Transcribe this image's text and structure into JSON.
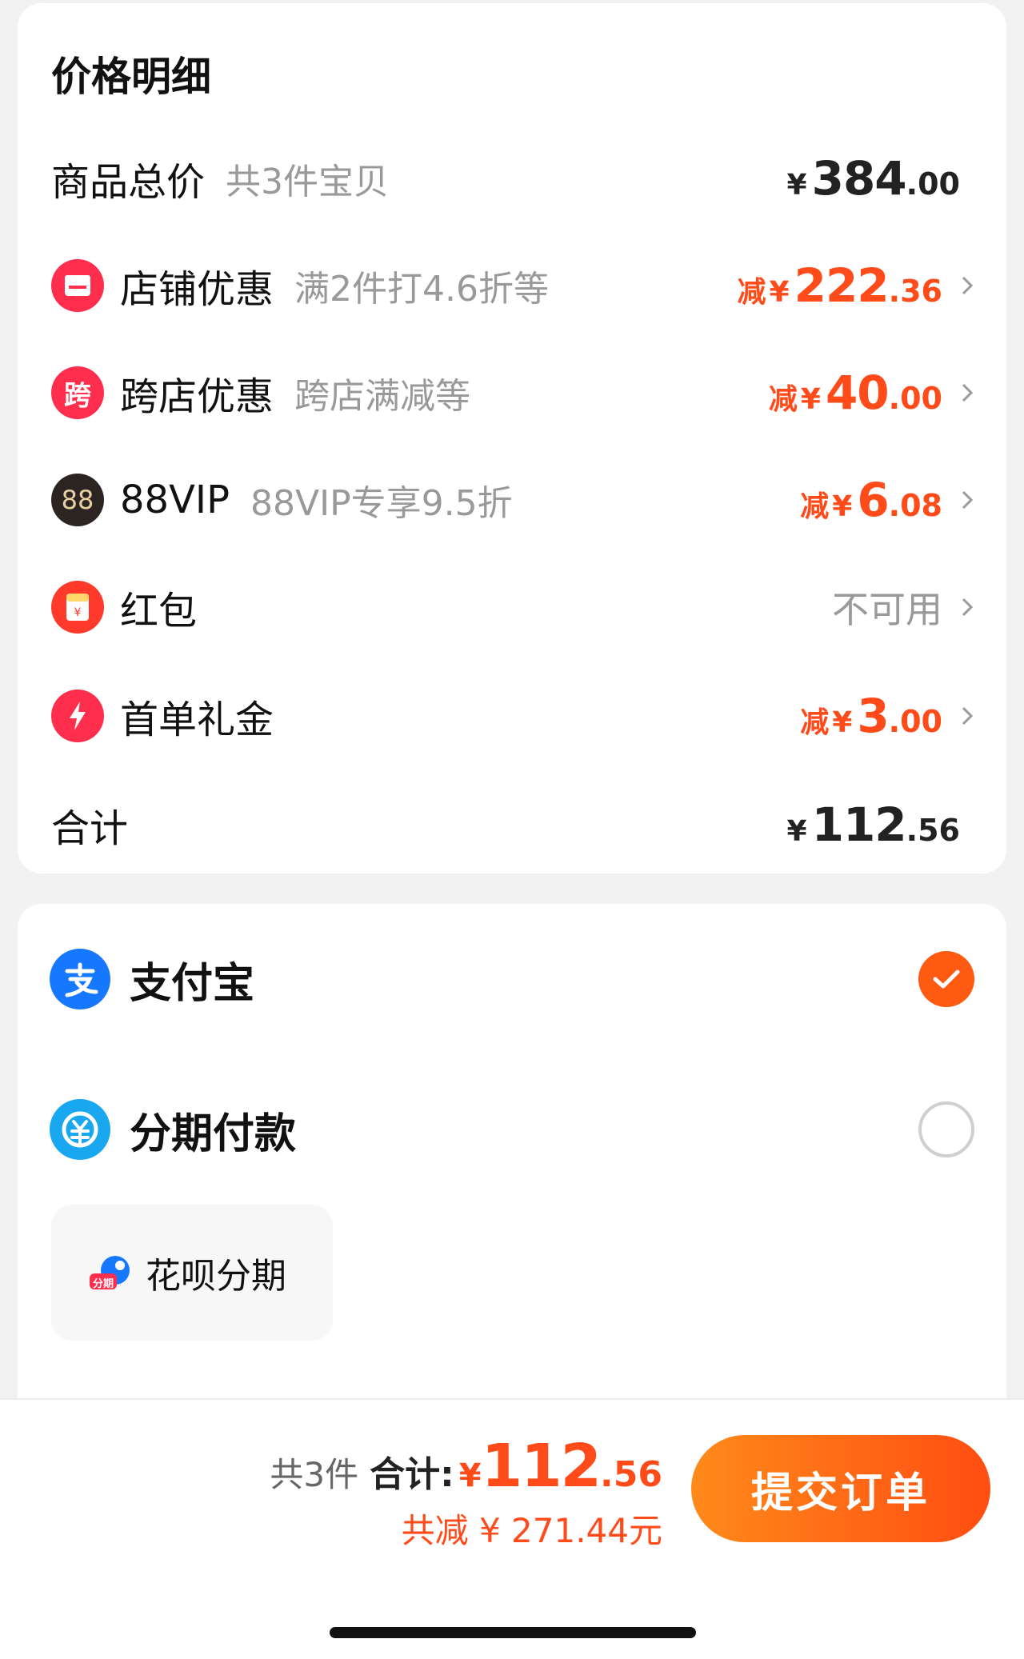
{
  "price_detail": {
    "title": "价格明细",
    "rows": [
      {
        "label": "商品总价",
        "desc": "共3件宝贝",
        "value_prefix": "",
        "yen": "¥",
        "value_int": "384",
        "value_dec": ".00"
      },
      {
        "label": "店铺优惠",
        "desc": "满2件打4.6折等",
        "value_prefix": "减",
        "yen": "¥",
        "value_int": "222",
        "value_dec": ".36",
        "icon": "shop-icon"
      },
      {
        "label": "跨店优惠",
        "desc": "跨店满减等",
        "value_prefix": "减",
        "yen": "¥",
        "value_int": "40",
        "value_dec": ".00",
        "icon": "cross-store-icon",
        "icon_text": "跨"
      },
      {
        "label": "88VIP",
        "desc": "88VIP专享9.5折",
        "value_prefix": "减",
        "yen": "¥",
        "value_int": "6",
        "value_dec": ".08",
        "icon": "vip-88-icon",
        "icon_text": "88"
      },
      {
        "label": "红包",
        "desc": "",
        "value_text": "不可用",
        "icon": "red-envelope-icon"
      },
      {
        "label": "首单礼金",
        "desc": "",
        "value_prefix": "减",
        "yen": "¥",
        "value_int": "3",
        "value_dec": ".00",
        "icon": "lightning-icon"
      },
      {
        "label": "合计",
        "desc": "",
        "value_prefix": "",
        "yen": "¥",
        "value_int": "112",
        "value_dec": ".56"
      }
    ]
  },
  "payment": {
    "options": [
      {
        "label": "支付宝",
        "icon": "alipay-icon",
        "selected": true
      },
      {
        "label": "分期付款",
        "icon": "installment-icon",
        "selected": false
      }
    ],
    "huabei": {
      "label": "花呗分期",
      "badge": "分期"
    }
  },
  "summary": {
    "count": "共3件",
    "total_label": "合计:",
    "yen": "¥",
    "total_int": "112",
    "total_dec": ".56",
    "saved": "共减 ¥ 271.44元",
    "submit_label": "提交订单"
  },
  "colors": {
    "accent": "#ff4a1a",
    "button_gradient_start": "#ff8a1a",
    "button_gradient_end": "#ff4d12"
  }
}
